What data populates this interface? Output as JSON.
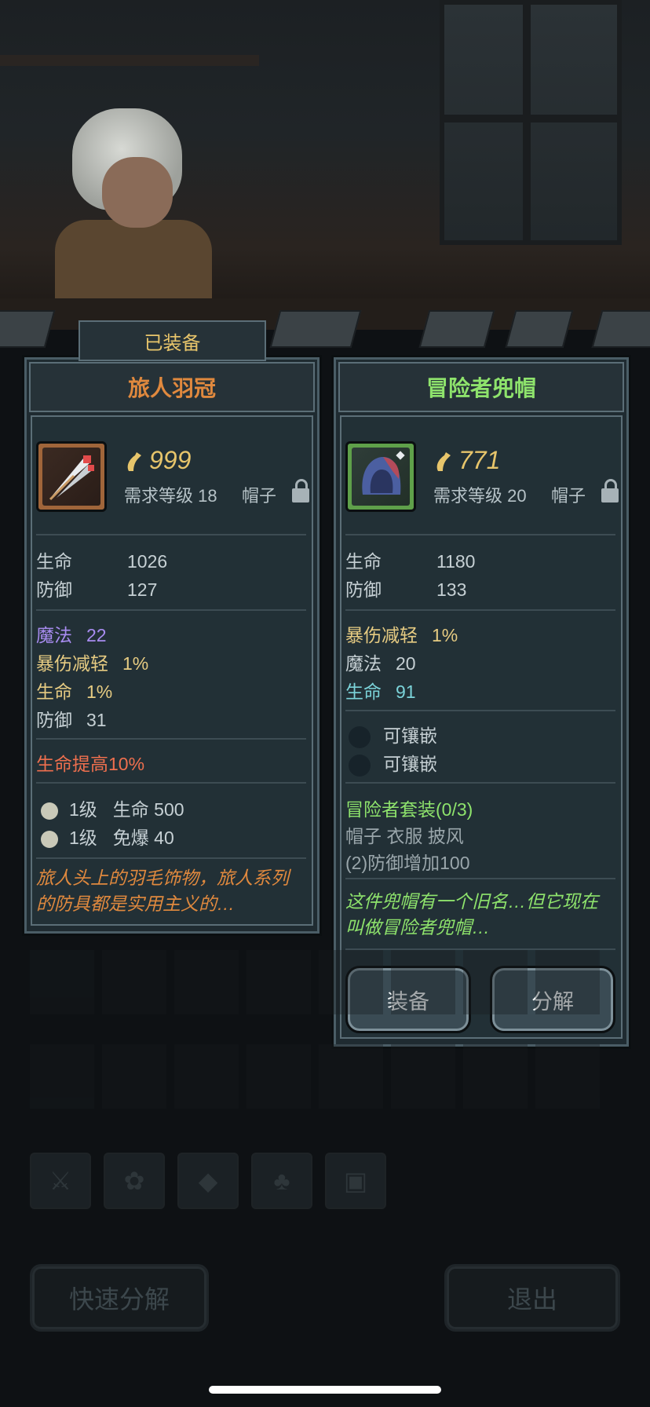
{
  "equipped_tab": "已装备",
  "left": {
    "name": "旅人羽冠",
    "price": "999",
    "req_level": "需求等级 18",
    "type": "帽子",
    "base_stats": [
      {
        "k": "生命",
        "v": "1026"
      },
      {
        "k": "防御",
        "v": "127"
      }
    ],
    "bonus_stats": [
      {
        "k": "魔法",
        "v": "22",
        "color": "#a88cf0"
      },
      {
        "k": "暴伤减轻",
        "v": "1%",
        "color": "#e6cb82"
      },
      {
        "k": "生命",
        "v": "1%",
        "color": "#e6cb82"
      },
      {
        "k": "防御",
        "v": "31",
        "color": "#c6d0d4"
      }
    ],
    "special": "生命提高10%",
    "gems": [
      {
        "level": "1级",
        "effect": "生命 500"
      },
      {
        "level": "1级",
        "effect": "免爆 40"
      }
    ],
    "desc_line1": "旅人头上的羽毛饰物，旅人系列",
    "desc_line2": "的防具都是实用主义的…"
  },
  "right": {
    "name": "冒险者兜帽",
    "price": "771",
    "req_level": "需求等级 20",
    "type": "帽子",
    "base_stats": [
      {
        "k": "生命",
        "v": "1180"
      },
      {
        "k": "防御",
        "v": "133"
      }
    ],
    "bonus_stats": [
      {
        "k": "暴伤减轻",
        "v": "1%",
        "color": "#e6cb82"
      },
      {
        "k": "魔法",
        "v": "20",
        "color": "#c6d0d4"
      },
      {
        "k": "生命",
        "v": "91",
        "color": "#7bd3d9"
      }
    ],
    "sockets": [
      "可镶嵌",
      "可镶嵌"
    ],
    "set_name": "冒险者套装(0/3)",
    "set_items": "帽子 衣服 披风",
    "set_bonus": "(2)防御增加100",
    "desc_line1": "这件兜帽有一个旧名…但它现在",
    "desc_line2": "叫做冒险者兜帽…",
    "equip_button": "装备",
    "dismantle_button": "分解"
  },
  "bottom": {
    "quick_dismantle": "快速分解",
    "exit": "退出"
  },
  "category_icons": [
    "weapon-icon",
    "paw-icon",
    "gem-icon",
    "leaf-icon",
    "chest-icon"
  ]
}
